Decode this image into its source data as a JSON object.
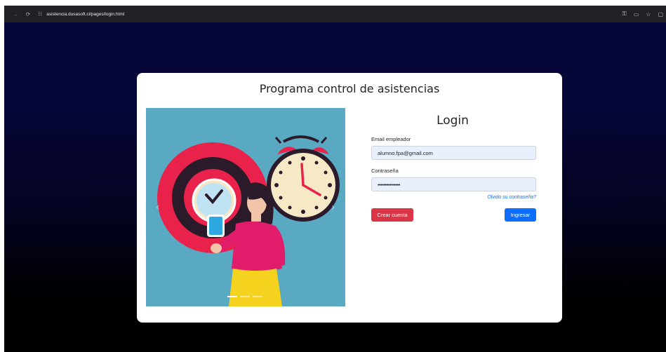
{
  "browser": {
    "url": "asistencia.dusasoft.cl/pages/login.html",
    "back_icon": "arrow-left-icon",
    "reload_icon": "reload-icon",
    "site_icon": "tune-icon"
  },
  "card": {
    "title": "Programa control de asistencias"
  },
  "login": {
    "title": "Login",
    "email_label": "Email empleador",
    "email_value": "alumno.fpa@gmail.com",
    "password_label": "Contraseña",
    "password_value": "•••••••••••••••",
    "forgot_link": "Olvido su contraseña?",
    "create_button": "Crear cuenta",
    "login_button": "Ingresar"
  },
  "colors": {
    "background_top": "#06063a",
    "background_bottom": "#000000",
    "primary": "#0d6efd",
    "danger": "#dc3545",
    "illustration_bg": "#5aa9c2"
  }
}
